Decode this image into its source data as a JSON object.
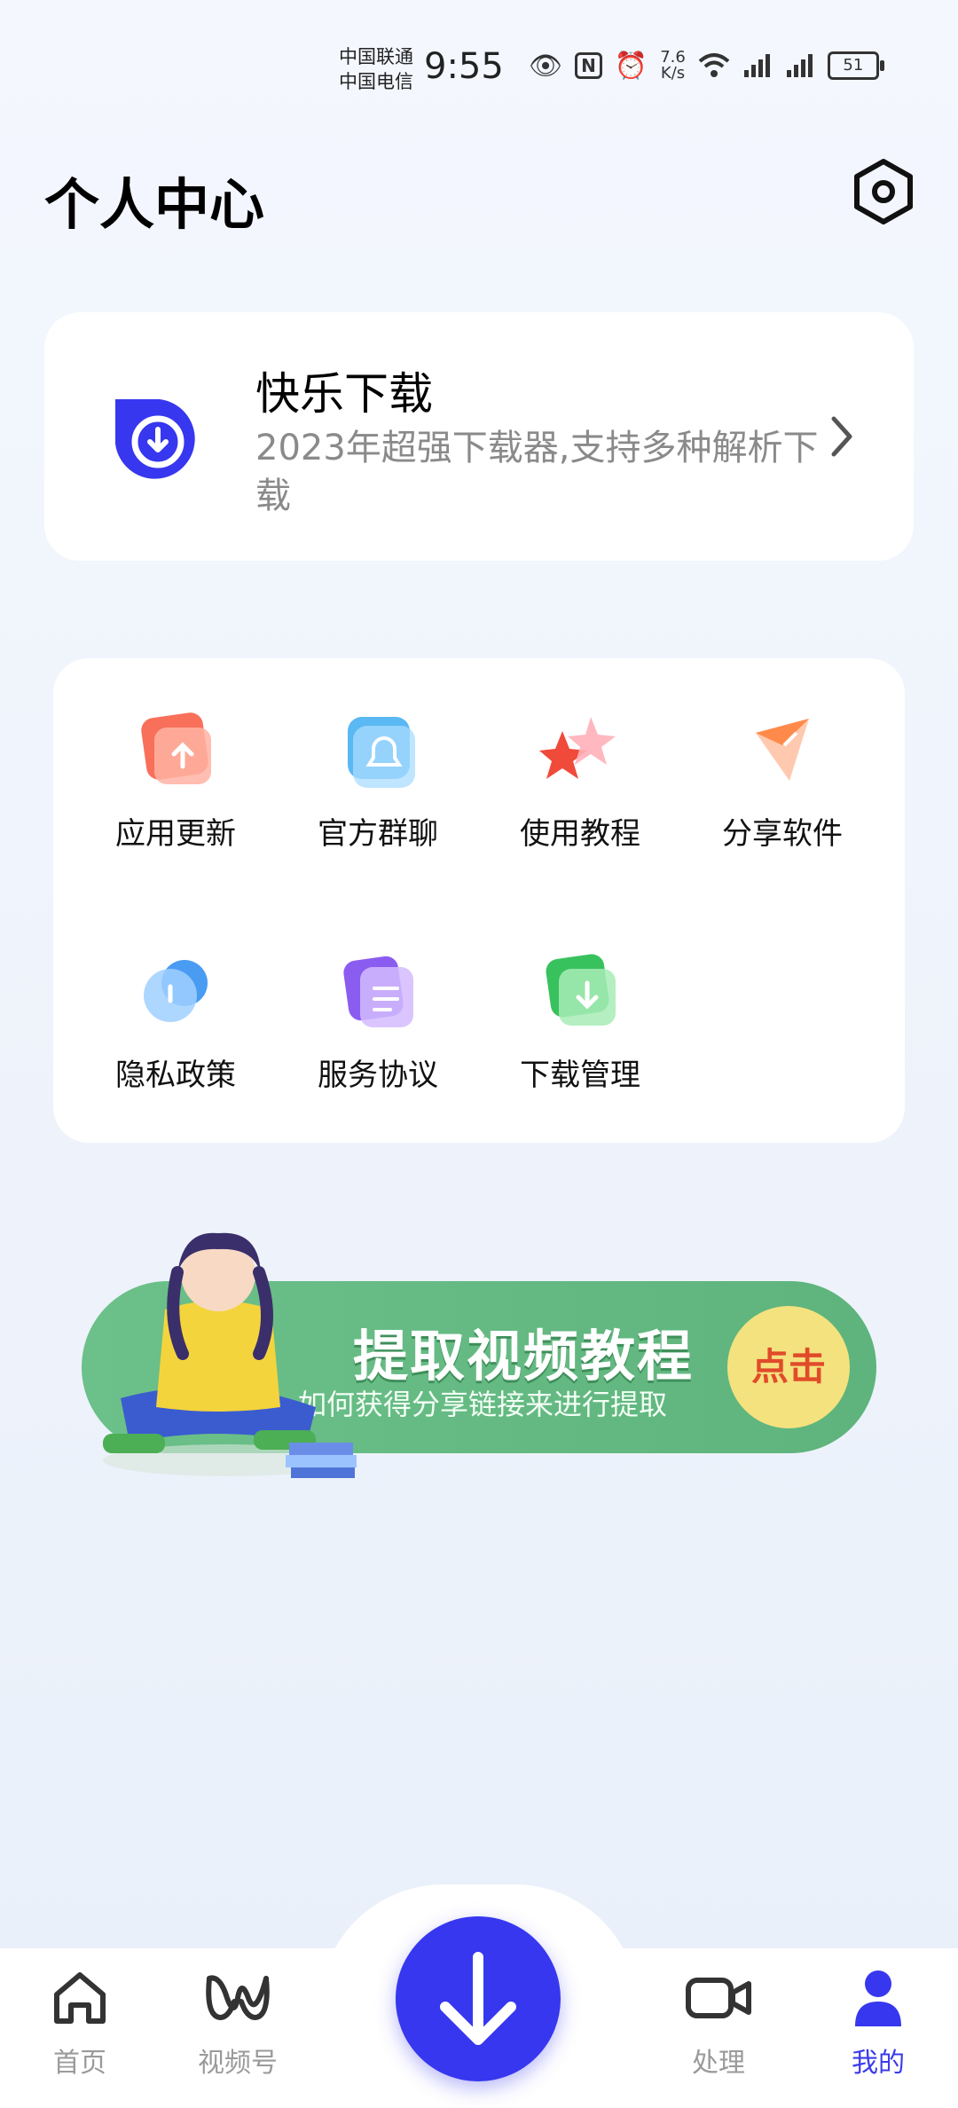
{
  "status_bar": {
    "carrier1": "中国联通",
    "carrier2": "中国电信",
    "time": "9:55",
    "speed_value": "7.6",
    "speed_unit": "K/s",
    "battery": "51"
  },
  "header": {
    "title": "个人中心"
  },
  "profile": {
    "name": "快乐下载",
    "description": "2023年超强下载器,支持多种解析下载"
  },
  "grid": {
    "items": [
      {
        "label": "应用更新",
        "icon": "update-icon"
      },
      {
        "label": "官方群聊",
        "icon": "chat-group-icon"
      },
      {
        "label": "使用教程",
        "icon": "star-tutorial-icon"
      },
      {
        "label": "分享软件",
        "icon": "share-icon"
      },
      {
        "label": "隐私政策",
        "icon": "privacy-icon"
      },
      {
        "label": "服务协议",
        "icon": "document-icon"
      },
      {
        "label": "下载管理",
        "icon": "download-manage-icon"
      }
    ]
  },
  "banner": {
    "title": "提取视频教程",
    "subtitle": "如何获得分享链接来进行提取",
    "button": "点击"
  },
  "bottom_nav": {
    "items": [
      {
        "label": "首页",
        "icon": "home-icon"
      },
      {
        "label": "视频号",
        "icon": "video-channel-icon"
      },
      {
        "label": "处理",
        "icon": "video-camera-icon"
      },
      {
        "label": "我的",
        "icon": "user-icon"
      }
    ],
    "active": "我的"
  },
  "colors": {
    "accent": "#3737ef",
    "banner_green": "#62b880",
    "banner_button": "#f4e27f"
  }
}
